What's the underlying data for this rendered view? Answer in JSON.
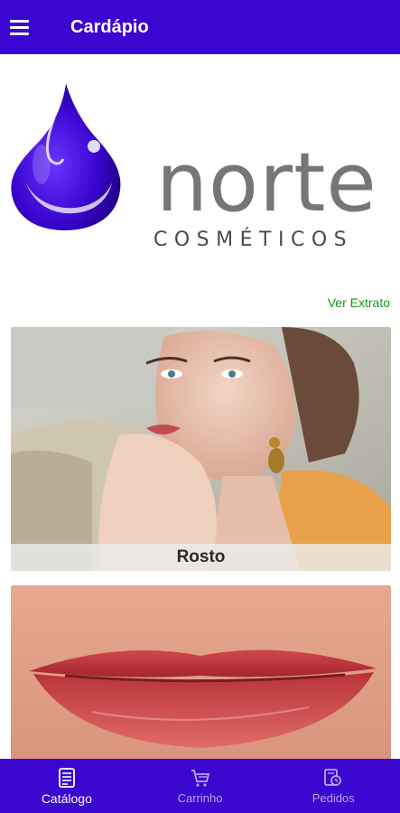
{
  "appbar": {
    "title": "Cardápio",
    "menu_icon": "menu-icon"
  },
  "logo": {
    "word": "norte",
    "subtitle": "COSMÉTICOS"
  },
  "extrato_link": "Ver Extrato",
  "categories": [
    {
      "label": "Rosto"
    },
    {
      "label": ""
    }
  ],
  "bottom_nav": {
    "items": [
      {
        "label": "Catálogo",
        "icon": "menu-book-icon",
        "active": true
      },
      {
        "label": "Carrinho",
        "icon": "cart-icon",
        "active": false
      },
      {
        "label": "Pedidos",
        "icon": "orders-icon",
        "active": false
      }
    ]
  },
  "colors": {
    "primary": "#3a06d0",
    "link": "#14961f",
    "logo_gray": "#767676"
  }
}
